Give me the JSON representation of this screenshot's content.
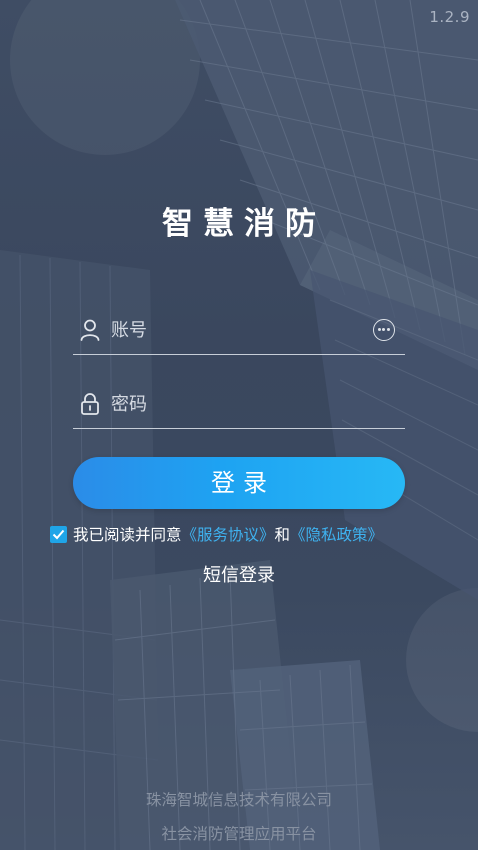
{
  "version": "1.2.9",
  "app_title": "智慧消防",
  "account": {
    "placeholder": "账号",
    "icon": "user-icon",
    "more_icon": "more-options-icon"
  },
  "password": {
    "placeholder": "密码",
    "icon": "lock-icon"
  },
  "login_button": "登录",
  "agreement": {
    "checked": true,
    "prefix": "我已阅读并同意",
    "service_link": "《服务协议》",
    "connector": "和",
    "privacy_link": "《隐私政策》"
  },
  "sms_login": "短信登录",
  "footer": {
    "company": "珠海智城信息技术有限公司",
    "platform": "社会消防管理应用平台"
  },
  "colors": {
    "background": "#3d4a61",
    "accent": "#1ea3f2",
    "link": "#3fb2f0"
  }
}
